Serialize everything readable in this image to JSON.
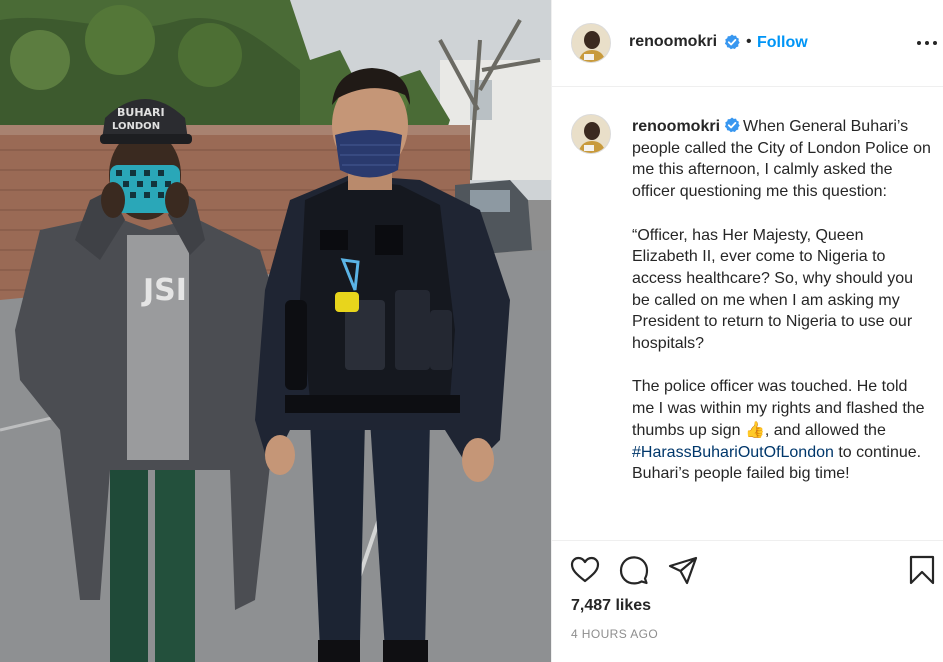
{
  "post": {
    "image_alt": "Two men standing on a street, one in a grey coat with a patterned face mask, the other a police officer in uniform with a blue mask"
  },
  "header": {
    "username": "renoomokri",
    "separator": "•",
    "follow_label": "Follow"
  },
  "caption": {
    "username": "renoomokri",
    "paragraph1": "When General Buhari’s people called the City of London Police on me this afternoon, I calmly asked the officer questioning me this question:",
    "paragraph2": "“Officer, has Her Majesty, Queen Elizabeth II, ever come to Nigeria to access healthcare? So, why should you be called on me when I am asking my President to return to Nigeria to use our hospitals?",
    "paragraph3_a": "The police officer was touched. He told me I was within my rights and flashed the thumbs up sign 👍, and allowed the",
    "hashtag": "#HarassBuhariOutOfLondon",
    "paragraph3_b": "to continue. Buhari’s people failed big time!"
  },
  "engagement": {
    "likes": "7,487 likes",
    "time_ago": "4 HOURS AGO"
  },
  "icons": {
    "like": "heart-icon",
    "comment": "comment-icon",
    "share": "paper-plane-icon",
    "save": "bookmark-icon",
    "options": "more-options-icon",
    "verified": "verified-badge-icon"
  },
  "colors": {
    "accent": "#0095f6",
    "verified": "#3897f0",
    "hashtag": "#00376b",
    "muted": "#8e8e8e"
  }
}
